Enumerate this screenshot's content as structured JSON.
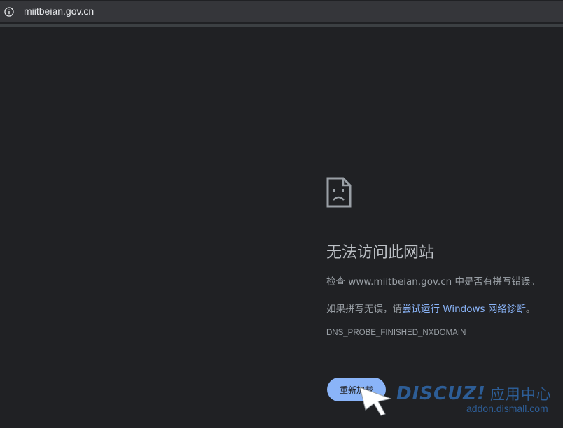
{
  "browser": {
    "url": "miitbeian.gov.cn",
    "info_icon": "info-icon"
  },
  "error": {
    "icon": "sad-document-icon",
    "title": "无法访问此网站",
    "check_prefix": "检查 www.miitbeian.gov.cn 中是否有拼写错误。",
    "suggest_prefix": "如果拼写无误，请",
    "suggest_link": "尝试运行 Windows 网络诊断",
    "suggest_suffix": "。",
    "error_code": "DNS_PROBE_FINISHED_NXDOMAIN",
    "reload_label": "重新加载"
  },
  "watermark": {
    "logo": "DISCUZ!",
    "logo_cn": "应用中心",
    "site": "addon.dismall.com"
  },
  "colors": {
    "background": "#202124",
    "accent": "#8ab4f8",
    "watermark": "#2d5d96"
  }
}
